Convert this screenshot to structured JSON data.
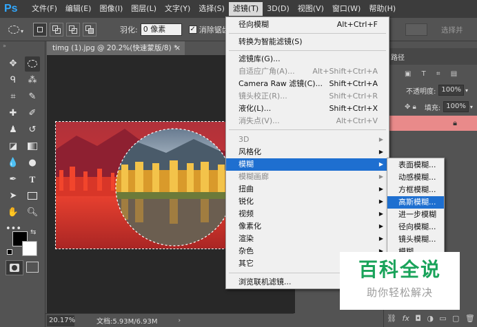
{
  "app": {
    "logo": "Ps"
  },
  "menubar": [
    "文件(F)",
    "编辑(E)",
    "图像(I)",
    "图层(L)",
    "文字(Y)",
    "选择(S)",
    "滤镜(T)",
    "3D(D)",
    "视图(V)",
    "窗口(W)",
    "帮助(H)"
  ],
  "options": {
    "feather_label": "羽化:",
    "feather_value": "0 像素",
    "antialias_label": "消除锯齿",
    "select_hint": "选择并"
  },
  "document": {
    "tab_title": "timg (1).jpg @ 20.2%(快速蒙版/8) *",
    "close": "×"
  },
  "status": {
    "zoom": "20.17%",
    "doc_info": "文档:5.93M/6.93M"
  },
  "right_panel": {
    "tab": "路径",
    "opacity_label": "不透明度:",
    "opacity_value": "100%",
    "fill_label": "填充:",
    "fill_value": "100%"
  },
  "filter_menu": {
    "top": [
      {
        "label": "径向模糊",
        "shortcut": "Alt+Ctrl+F"
      }
    ],
    "smart": [
      {
        "label": "转换为智能滤镜(S)"
      }
    ],
    "group2": [
      {
        "label": "滤镜库(G)...",
        "shortcut": "",
        "disabled": false
      },
      {
        "label": "自适应广角(A)...",
        "shortcut": "Alt+Shift+Ctrl+A",
        "disabled": true
      },
      {
        "label": "Camera Raw 滤镜(C)...",
        "shortcut": "Shift+Ctrl+A",
        "disabled": false
      },
      {
        "label": "镜头校正(R)...",
        "shortcut": "Shift+Ctrl+R",
        "disabled": true
      },
      {
        "label": "液化(L)...",
        "shortcut": "Shift+Ctrl+X",
        "disabled": false
      },
      {
        "label": "消失点(V)...",
        "shortcut": "Alt+Ctrl+V",
        "disabled": true
      }
    ],
    "group3": [
      {
        "label": "3D",
        "disabled": true
      },
      {
        "label": "风格化",
        "disabled": false
      },
      {
        "label": "模糊",
        "disabled": false,
        "highlighted": true
      },
      {
        "label": "模糊画廊",
        "disabled": true
      },
      {
        "label": "扭曲",
        "disabled": false
      },
      {
        "label": "锐化",
        "disabled": false
      },
      {
        "label": "视频",
        "disabled": false
      },
      {
        "label": "像素化",
        "disabled": false
      },
      {
        "label": "渲染",
        "disabled": false
      },
      {
        "label": "杂色",
        "disabled": false
      },
      {
        "label": "其它",
        "disabled": false
      }
    ],
    "bottom": [
      {
        "label": "浏览联机滤镜..."
      }
    ]
  },
  "blur_submenu": [
    "表面模糊...",
    "动感模糊...",
    "方框模糊...",
    "高斯模糊...",
    "进一步模糊",
    "径向模糊...",
    "镜头模糊...",
    "模糊"
  ],
  "blur_submenu_highlight": 3,
  "watermark": {
    "title": "百科全说",
    "subtitle": "助你轻松解决"
  },
  "colors": {
    "accent": "#1e6fd0",
    "brand": "#31a8ff",
    "watermark_green": "#19a35a"
  }
}
